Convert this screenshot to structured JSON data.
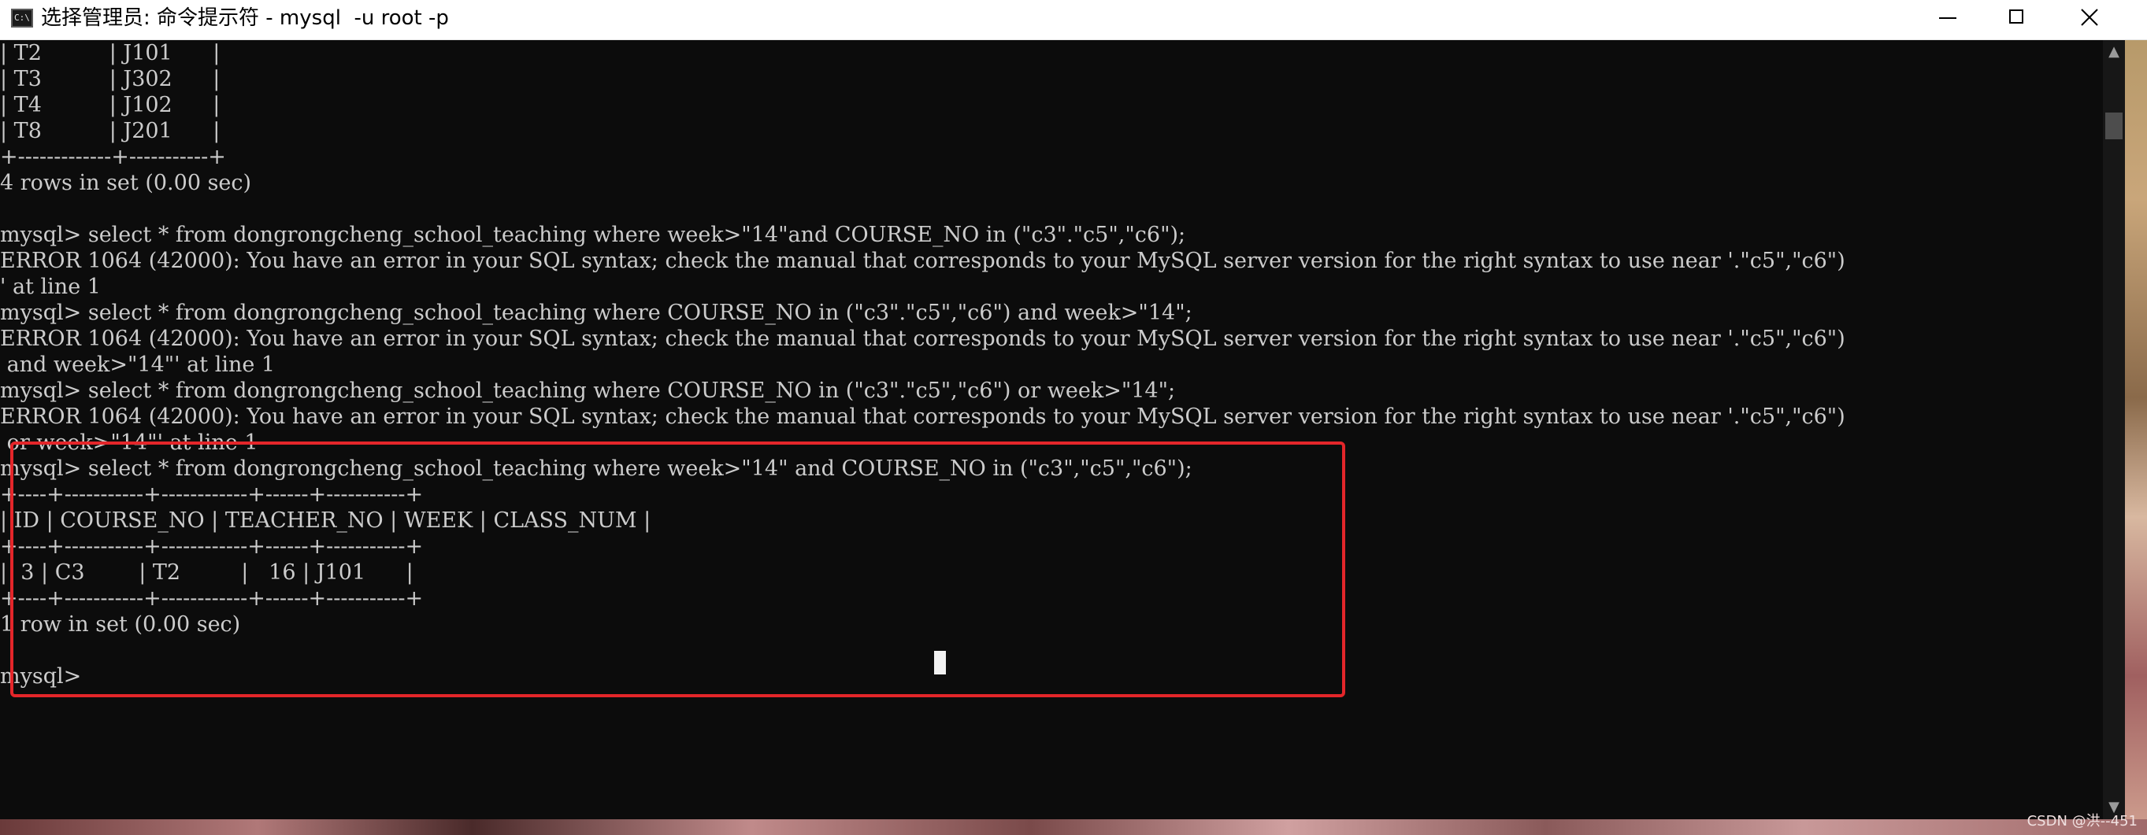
{
  "window": {
    "title": "选择管理员: 命令提示符 - mysql  -u root -p",
    "icon_text": "C:\\"
  },
  "console": {
    "lines": [
      "| T2          | J101      |",
      "| T3          | J302      |",
      "| T4          | J102      |",
      "| T8          | J201      |",
      "+-------------+-----------+",
      "4 rows in set (0.00 sec)",
      "",
      "mysql> select * from dongrongcheng_school_teaching where week>\"14\"and COURSE_NO in (\"c3\".\"c5\",\"c6\");",
      "ERROR 1064 (42000): You have an error in your SQL syntax; check the manual that corresponds to your MySQL server version for the right syntax to use near '.\"c5\",\"c6\")",
      "' at line 1",
      "mysql> select * from dongrongcheng_school_teaching where COURSE_NO in (\"c3\".\"c5\",\"c6\") and week>\"14\";",
      "ERROR 1064 (42000): You have an error in your SQL syntax; check the manual that corresponds to your MySQL server version for the right syntax to use near '.\"c5\",\"c6\")",
      " and week>\"14\"' at line 1",
      "mysql> select * from dongrongcheng_school_teaching where COURSE_NO in (\"c3\".\"c5\",\"c6\") or week>\"14\";",
      "ERROR 1064 (42000): You have an error in your SQL syntax; check the manual that corresponds to your MySQL server version for the right syntax to use near '.\"c5\",\"c6\")",
      " or week>\"14\"' at line 1",
      "mysql> select * from dongrongcheng_school_teaching where week>\"14\" and COURSE_NO in (\"c3\",\"c5\",\"c6\");",
      "+----+-----------+------------+------+-----------+",
      "| ID | COURSE_NO | TEACHER_NO | WEEK | CLASS_NUM |",
      "+----+-----------+------------+------+-----------+",
      "|  3 | C3        | T2         |   16 | J101      |",
      "+----+-----------+------------+------+-----------+",
      "1 row in set (0.00 sec)",
      "",
      "mysql>"
    ]
  },
  "watermark": "CSDN @洪--451",
  "colors": {
    "console_bg": "#0c0c0c",
    "console_text": "#cccccc",
    "annotation": "#e4262a",
    "titlebar_bg": "#ffffff"
  },
  "icons": {
    "app": "cmd-icon",
    "minimize": "minimize-icon",
    "maximize": "maximize-icon",
    "close": "close-icon"
  }
}
